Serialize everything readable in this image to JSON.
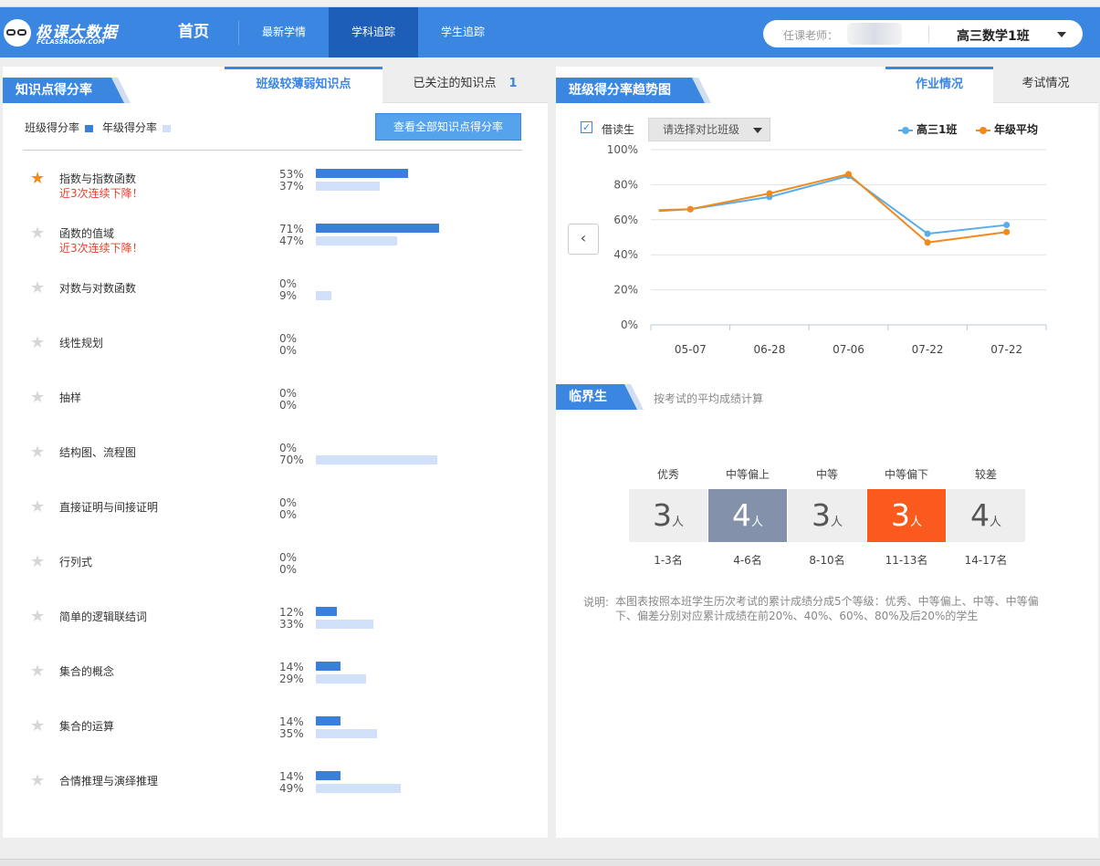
{
  "header": {
    "logo_title": "极课大数据",
    "logo_sub": "FCLASSROOM.COM",
    "nav": [
      {
        "label": "首页"
      },
      {
        "label": "最新学情"
      },
      {
        "label": "学科追踪"
      },
      {
        "label": "学生追踪"
      }
    ],
    "teacher_label": "任课老师：",
    "class_name": "高三数学1班"
  },
  "left": {
    "section_title": "知识点得分率",
    "tabs": [
      {
        "label": "班级较薄弱知识点"
      },
      {
        "label": "已关注的知识点",
        "count": "1"
      }
    ],
    "legend_class": "班级得分率",
    "legend_grade": "年级得分率",
    "view_all_button": "查看全部知识点得分率",
    "colors": {
      "class_bar": "#3a7fdc",
      "grade_bar": "#cfe0f8",
      "star_on": "#f08c1a",
      "star_off": "#d6d6d6",
      "warn": "#e8412b"
    },
    "points": [
      {
        "name": "指数与指数函数",
        "warning": "近3次连续下降！",
        "starred": true,
        "class_pct": "53%",
        "grade_pct": "37%",
        "class_val": 53,
        "grade_val": 37
      },
      {
        "name": "函数的值域",
        "warning": "近3次连续下降！",
        "starred": false,
        "class_pct": "71%",
        "grade_pct": "47%",
        "class_val": 71,
        "grade_val": 47
      },
      {
        "name": "对数与对数函数",
        "warning": "",
        "starred": false,
        "class_pct": "0%",
        "grade_pct": "9%",
        "class_val": 0,
        "grade_val": 9
      },
      {
        "name": "线性规划",
        "warning": "",
        "starred": false,
        "class_pct": "0%",
        "grade_pct": "0%",
        "class_val": 0,
        "grade_val": 0
      },
      {
        "name": "抽样",
        "warning": "",
        "starred": false,
        "class_pct": "0%",
        "grade_pct": "0%",
        "class_val": 0,
        "grade_val": 0
      },
      {
        "name": "结构图、流程图",
        "warning": "",
        "starred": false,
        "class_pct": "0%",
        "grade_pct": "70%",
        "class_val": 0,
        "grade_val": 70
      },
      {
        "name": "直接证明与间接证明",
        "warning": "",
        "starred": false,
        "class_pct": "0%",
        "grade_pct": "0%",
        "class_val": 0,
        "grade_val": 0
      },
      {
        "name": "行列式",
        "warning": "",
        "starred": false,
        "class_pct": "0%",
        "grade_pct": "0%",
        "class_val": 0,
        "grade_val": 0
      },
      {
        "name": "简单的逻辑联结词",
        "warning": "",
        "starred": false,
        "class_pct": "12%",
        "grade_pct": "33%",
        "class_val": 12,
        "grade_val": 33
      },
      {
        "name": "集合的概念",
        "warning": "",
        "starred": false,
        "class_pct": "14%",
        "grade_pct": "29%",
        "class_val": 14,
        "grade_val": 29
      },
      {
        "name": "集合的运算",
        "warning": "",
        "starred": false,
        "class_pct": "14%",
        "grade_pct": "35%",
        "class_val": 14,
        "grade_val": 35
      },
      {
        "name": "合情推理与演绎推理",
        "warning": "",
        "starred": false,
        "class_pct": "14%",
        "grade_pct": "49%",
        "class_val": 14,
        "grade_val": 49
      }
    ]
  },
  "right": {
    "section_title": "班级得分率趋势图",
    "tabs": [
      {
        "label": "作业情况"
      },
      {
        "label": "考试情况"
      }
    ],
    "borrow_checkbox": "借读生",
    "borrow_checked": true,
    "compare_placeholder": "请选择对比班级",
    "chart_data": {
      "type": "line",
      "categories": [
        "05-07",
        "06-28",
        "07-06",
        "07-22",
        "07-22"
      ],
      "y_ticks": [
        "0%",
        "20%",
        "40%",
        "60%",
        "80%",
        "100%"
      ],
      "ylim": [
        0,
        100
      ],
      "grid": true,
      "legend_position": "top-right",
      "series": [
        {
          "name": "高三1班",
          "color": "#5aaee8",
          "points": [
            [
              0.02,
              65
            ],
            [
              0.1,
              66
            ],
            [
              0.3,
              73
            ],
            [
              0.5,
              85
            ],
            [
              0.7,
              52
            ],
            [
              0.9,
              57
            ]
          ]
        },
        {
          "name": "年级平均",
          "color": "#f0891e",
          "points": [
            [
              0.02,
              65.5
            ],
            [
              0.1,
              66
            ],
            [
              0.3,
              75
            ],
            [
              0.5,
              86
            ],
            [
              0.7,
              47
            ],
            [
              0.9,
              53
            ]
          ]
        }
      ]
    },
    "critical": {
      "title": "临界生",
      "subtitle": "按考试的平均成绩计算",
      "unit": "人",
      "levels": [
        {
          "label": "优秀",
          "count": "3",
          "range": "1-3名",
          "bg": "#eeeeee",
          "fg": "#555555"
        },
        {
          "label": "中等偏上",
          "count": "4",
          "range": "4-6名",
          "bg": "#8491aa",
          "fg": "#ffffff"
        },
        {
          "label": "中等",
          "count": "3",
          "range": "8-10名",
          "bg": "#eeeeee",
          "fg": "#555555"
        },
        {
          "label": "中等偏下",
          "count": "3",
          "range": "11-13名",
          "bg": "#fa5a1e",
          "fg": "#ffffff"
        },
        {
          "label": "较差",
          "count": "4",
          "range": "14-17名",
          "bg": "#eeeeee",
          "fg": "#555555"
        }
      ],
      "note_label": "说明:",
      "note": "本图表按照本班学生历次考试的累计成绩分成5个等级：优秀、中等偏上、中等、中等偏下、偏差分别对应累计成绩在前20%、40%、60%、80%及后20%的学生"
    }
  }
}
